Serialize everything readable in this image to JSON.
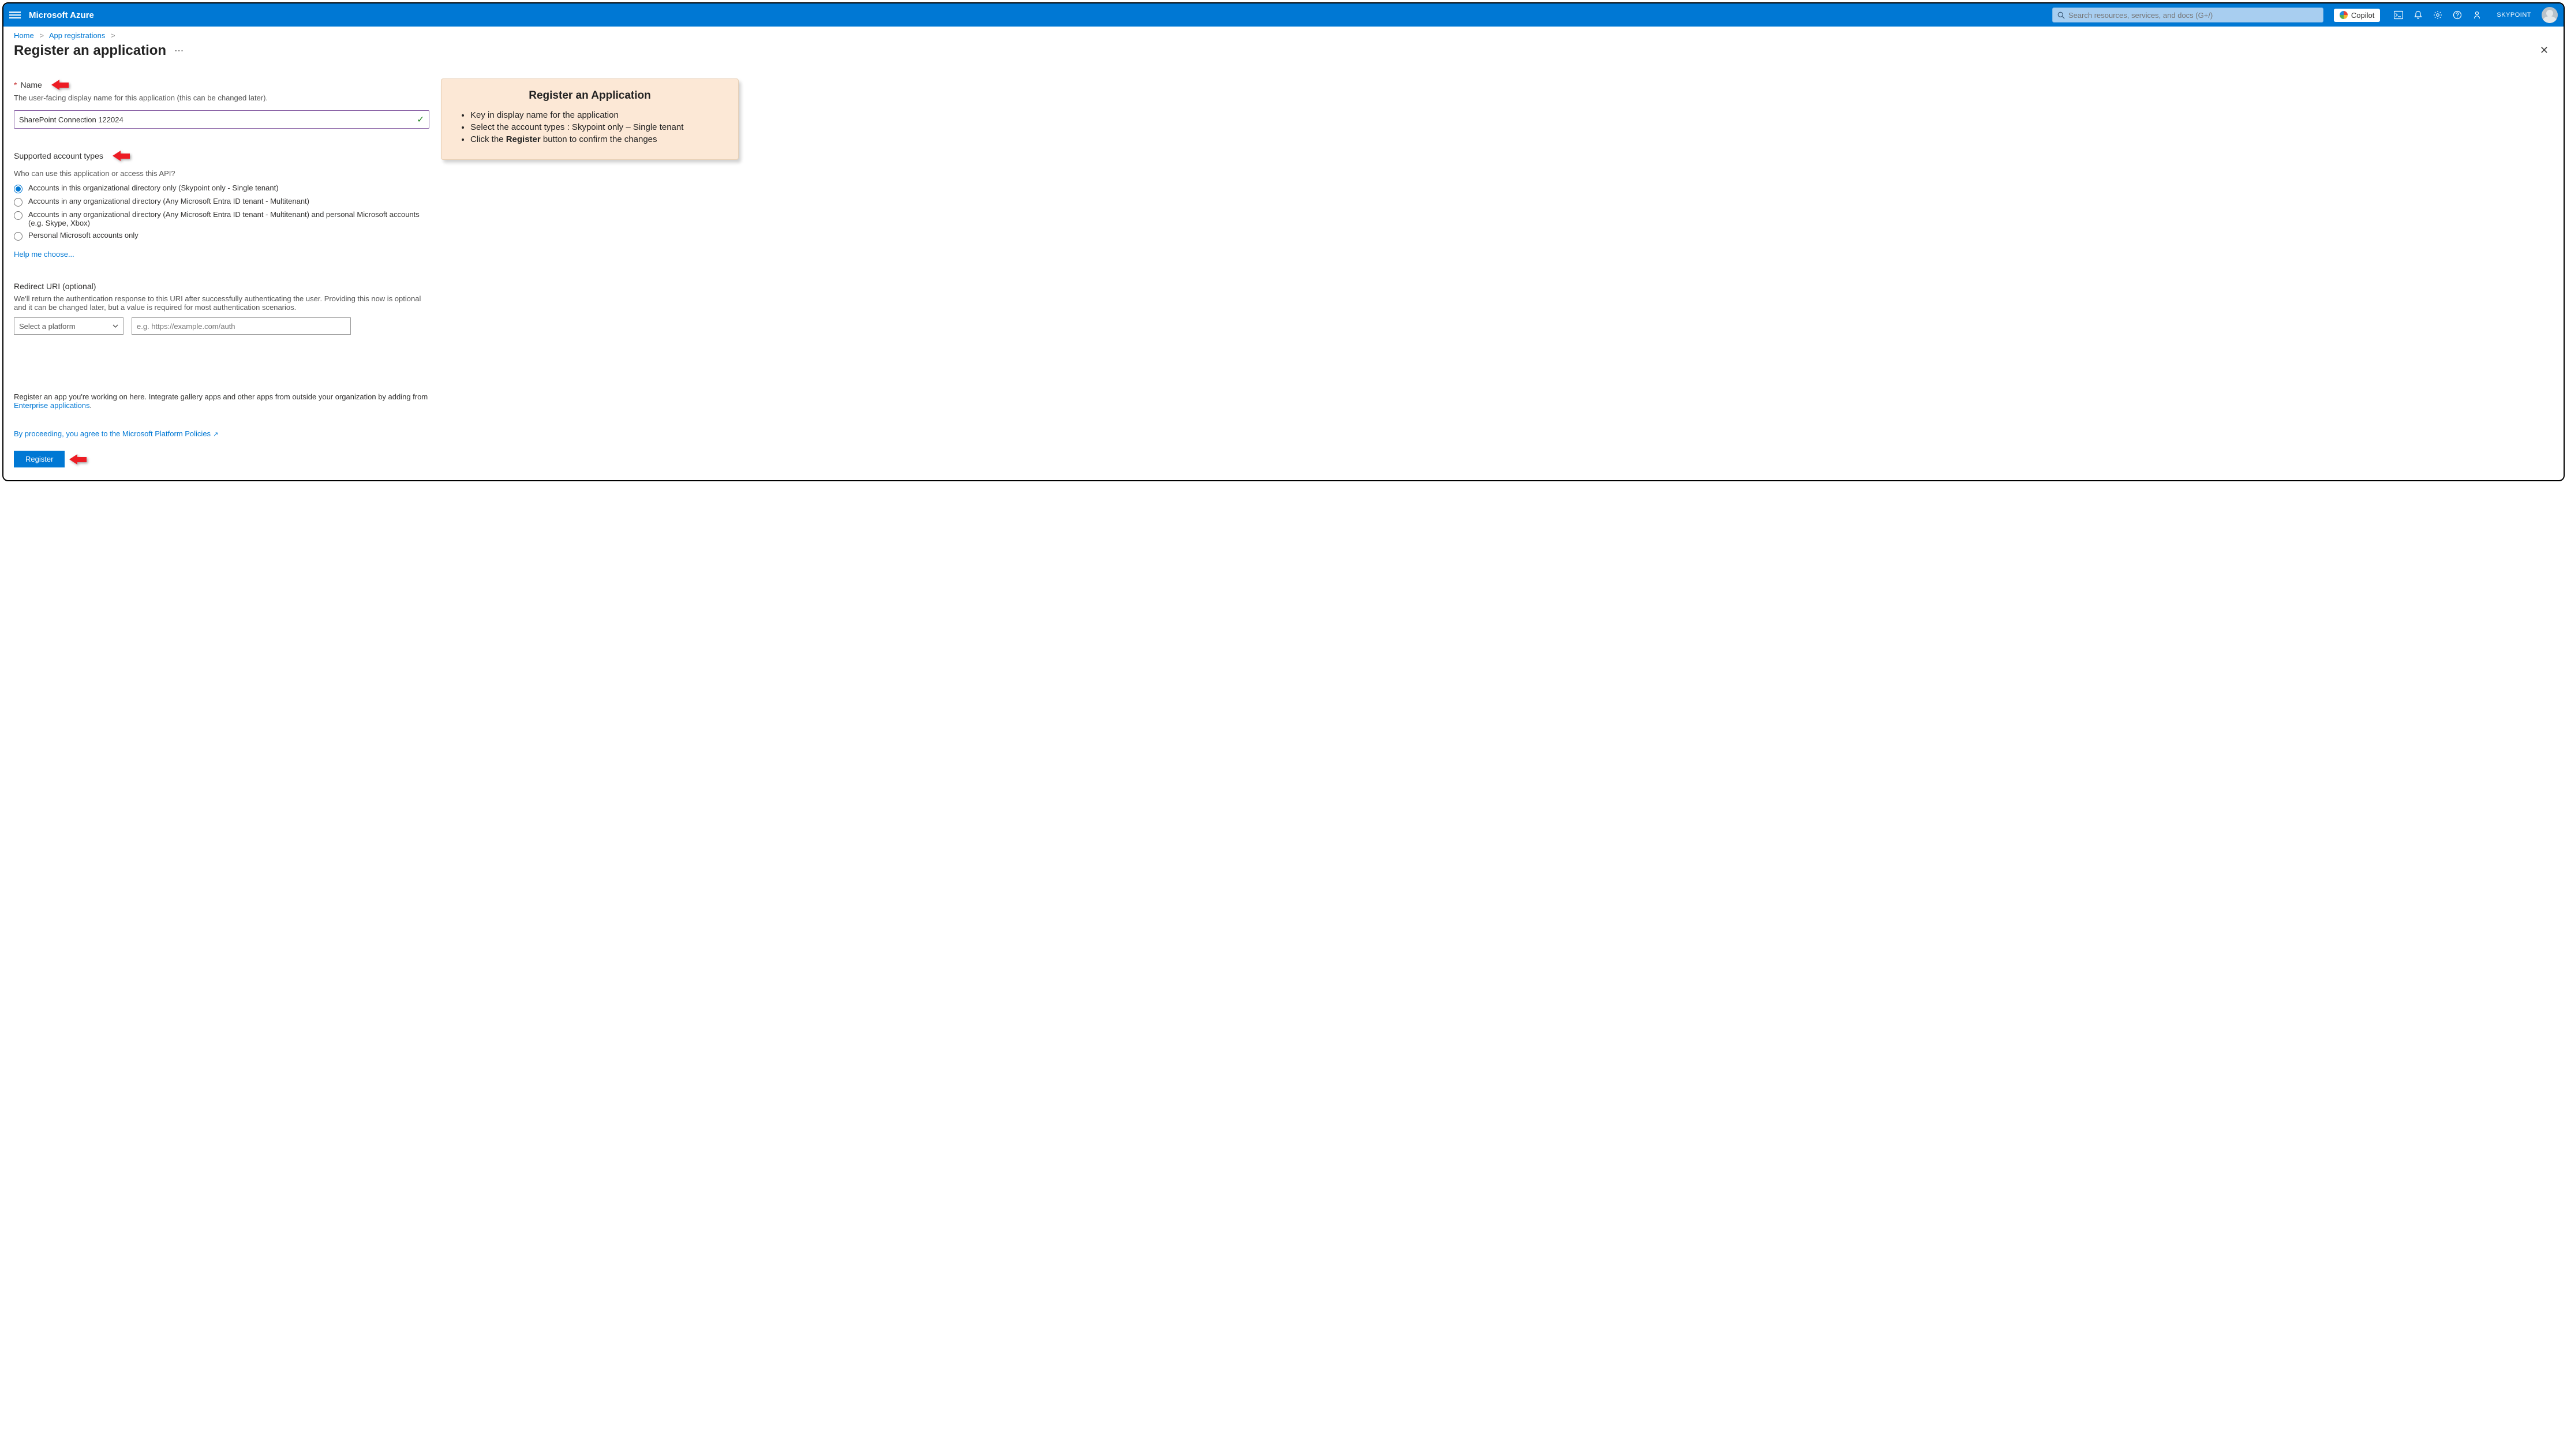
{
  "header": {
    "brand": "Microsoft Azure",
    "search_placeholder": "Search resources, services, and docs (G+/)",
    "copilot_label": "Copilot",
    "tenant": "SKYPOINT"
  },
  "breadcrumbs": {
    "items": [
      "Home",
      "App registrations"
    ]
  },
  "page": {
    "title": "Register an application"
  },
  "form": {
    "name_label": "Name",
    "name_help": "The user-facing display name for this application (this can be changed later).",
    "name_value": "SharePoint Connection 122024",
    "account_types_label": "Supported account types",
    "account_types_help": "Who can use this application or access this API?",
    "account_options": [
      "Accounts in this organizational directory only (Skypoint only - Single tenant)",
      "Accounts in any organizational directory (Any Microsoft Entra ID tenant - Multitenant)",
      "Accounts in any organizational directory (Any Microsoft Entra ID tenant - Multitenant) and personal Microsoft accounts (e.g. Skype, Xbox)",
      "Personal Microsoft accounts only"
    ],
    "account_selected_index": 0,
    "help_me_choose": "Help me choose...",
    "redirect_label": "Redirect URI (optional)",
    "redirect_help": "We'll return the authentication response to this URI after successfully authenticating the user. Providing this now is optional and it can be changed later, but a value is required for most authentication scenarios.",
    "platform_placeholder": "Select a platform",
    "uri_placeholder": "e.g. https://example.com/auth",
    "footer_note_prefix": "Register an app you're working on here. Integrate gallery apps and other apps from outside your organization by adding from ",
    "footer_note_link": "Enterprise applications",
    "policies_link": "By proceeding, you agree to the Microsoft Platform Policies",
    "register_button": "Register"
  },
  "callout": {
    "title": "Register an Application",
    "items": [
      "Key in display name for the application",
      "Select the account types : Skypoint only – Single tenant",
      "Click the Register button to confirm the changes"
    ],
    "bold_word": "Register"
  }
}
